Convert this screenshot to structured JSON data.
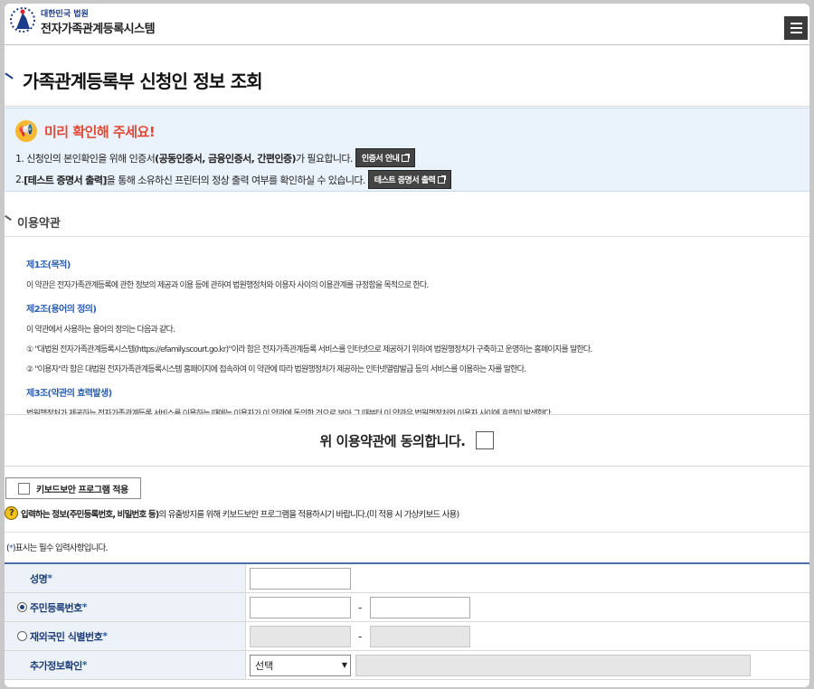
{
  "header": {
    "court_name": "대한민국 법원",
    "system_name": "전자가족관계등록시스템",
    "menu_icon": "hamburger-icon"
  },
  "page": {
    "title": "가족관계등록부 신청인 정보 조회"
  },
  "notice": {
    "title": "미리 확인해 주세요!",
    "line1_a": "1. 신청인의 본인확인을 위해 인증서",
    "line1_b": "(공동인증서, 금융인증서, 간편인증)",
    "line1_c": "가 필요합니다.",
    "cert_btn": "인증서 안내",
    "line2_a": "2.",
    "line2_b": "[테스트 증명서 출력]",
    "line2_c": "을 통해 소유하신 프린터의 정상 출력 여부를 확인하실 수 있습니다.",
    "test_btn": "테스트 증명서 출력"
  },
  "terms": {
    "title": "이용약관",
    "art1_title": "제1조(목적)",
    "art1_body": "이 약관은 전자가족관계등록에 관한 정보의 제공과 이용 등에 관하여 법원행정처와 이용자 사이의 이용관계를 규정함을 목적으로 한다.",
    "art2_title": "제2조(용어의 정의)",
    "art2_intro": "이 약관에서 사용하는 용어의 정의는 다음과 같다.",
    "art2_item1": "① \"대법원 전자가족관계등록시스템(https://efamily.scourt.go.kr)\"이라 함은 전자가족관계등록 서비스를 인터넷으로 제공하기 위하여 법원행정처가 구축하고 운영하는 홈페이지를 말한다.",
    "art2_item2": "② \"이용자\"라 함은 대법원 전자가족관계등록시스템 홈페이지에 접속하여 이 약관에 따라 법원행정처가 제공하는 인터넷열람발급 등의 서비스를 이용하는 자를 말한다.",
    "art3_title": "제3조(약관의 효력발생)",
    "art3_body": "법원행정처가 제공하는 전자가족관계등록 서비스를 이용하는 때에는 이용자가 이 약관에 동의한 것으로 보아 그 때부터 이 약관은 법원행정처와 이용자 사이에 효력이 발생한다.",
    "agree_text": "위 이용약관에 동의합니다."
  },
  "keyboard": {
    "button_label": "키보드보안 프로그램 적용",
    "info_bold": "입력하는 정보(주민등록번호, 비밀번호 등)",
    "info_rest": "의 유출방지를 위해 키보드보안 프로그램을 적용하시기 바랍니다.(미 적용 시 가상키보드 사용)",
    "info_icon": "question-icon"
  },
  "form": {
    "required_note_a": "(",
    "required_note_star": "*",
    "required_note_b": ")표시는 필수 입력사항입니다.",
    "name_label": "성명",
    "rrn_label": "주민등록번호",
    "foreign_label": "재외국민 식별번호",
    "extra_label": "추가정보확인",
    "req_mark": "*",
    "dash": "-",
    "select_value": "선택",
    "rrn_selected": true
  }
}
